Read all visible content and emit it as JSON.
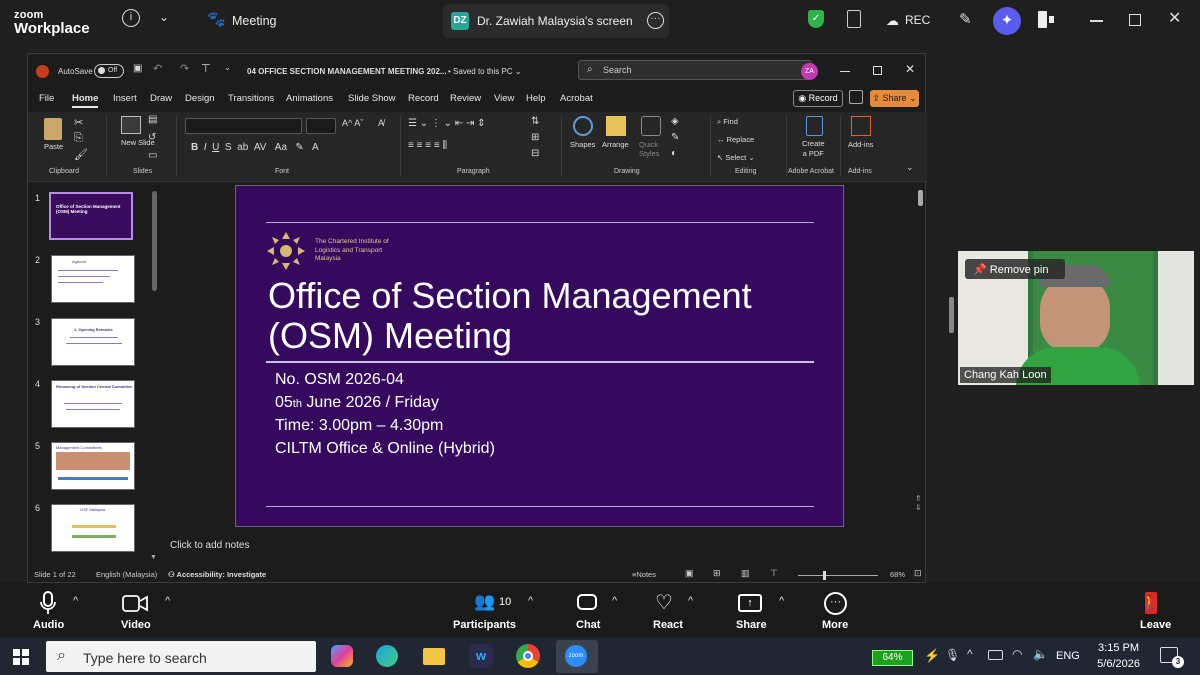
{
  "zoom": {
    "logo_line1": "zoom",
    "logo_line2": "Workplace",
    "meeting_label": "Meeting",
    "share_badge": "DZ",
    "share_title": "Dr. Zawiah Malaysia's screen",
    "rec_label": "REC"
  },
  "ppt": {
    "autosave": "AutoSave",
    "autosave_state": "Off",
    "doc_title": "04 OFFICE SECTION MANAGEMENT MEETING  202...",
    "saved": "Saved to this PC",
    "search_placeholder": "Search",
    "user_initials": "ZA",
    "menu": [
      "File",
      "Home",
      "Insert",
      "Draw",
      "Design",
      "Transitions",
      "Animations",
      "Slide Show",
      "Record",
      "Review",
      "View",
      "Help",
      "Acrobat"
    ],
    "record_btn": "Record",
    "share_btn": "Share",
    "ribbon": {
      "paste": "Paste",
      "new_slide": "New Slide",
      "find": "Find",
      "replace": "Replace",
      "select": "Select",
      "shapes": "Shapes",
      "arrange": "Arrange",
      "quick_styles": "Quick Styles",
      "create_pdf_1": "Create",
      "create_pdf_2": "a PDF",
      "addins": "Add-ins",
      "groups": [
        "Clipboard",
        "Slides",
        "Font",
        "Paragraph",
        "Drawing",
        "Editing",
        "Adobe Acrobat",
        "Add-ins"
      ]
    },
    "thumbs": [
      {
        "num": "1",
        "title": "Office of Section Management (OSM) Meeting"
      },
      {
        "num": "2",
        "title": "Agenda"
      },
      {
        "num": "3",
        "title": "1. Opening Remarks"
      },
      {
        "num": "4",
        "title": "Renaming of Section Central Committee"
      },
      {
        "num": "5",
        "title": "Management Committees"
      },
      {
        "num": "6",
        "title": "OSF Malaysia"
      }
    ],
    "slide": {
      "org_line1": "The Chartered Institute of",
      "org_line2": "Logistics and Transport",
      "org_line3": "Malaysia",
      "title_line1": "Office of Section Management",
      "title_line2": "(OSM) Meeting",
      "no": "No. OSM 2026-04",
      "date_pre": "05",
      "date_sup": "th",
      "date_post": " June 2026 / Friday",
      "time": "Time: 3.00pm – 4.30pm",
      "venue": "CILTM Office & Online (Hybrid)"
    },
    "notes": "Click to add notes",
    "status": {
      "slide": "Slide 1 of 22",
      "lang": "English (Malaysia)",
      "access": "Accessibility: Investigate",
      "notes": "Notes",
      "zoom": "68%"
    }
  },
  "video": {
    "remove_pin": "Remove pin",
    "name": "Chang Kah Loon"
  },
  "controls": {
    "audio": "Audio",
    "video": "Video",
    "participants": "Participants",
    "participants_count": "10",
    "chat": "Chat",
    "react": "React",
    "share": "Share",
    "more": "More",
    "leave": "Leave"
  },
  "taskbar": {
    "search_placeholder": "Type here to search",
    "battery": "64%",
    "lang": "ENG",
    "time": "3:15 PM",
    "date": "5/6/2026",
    "notif": "3"
  }
}
